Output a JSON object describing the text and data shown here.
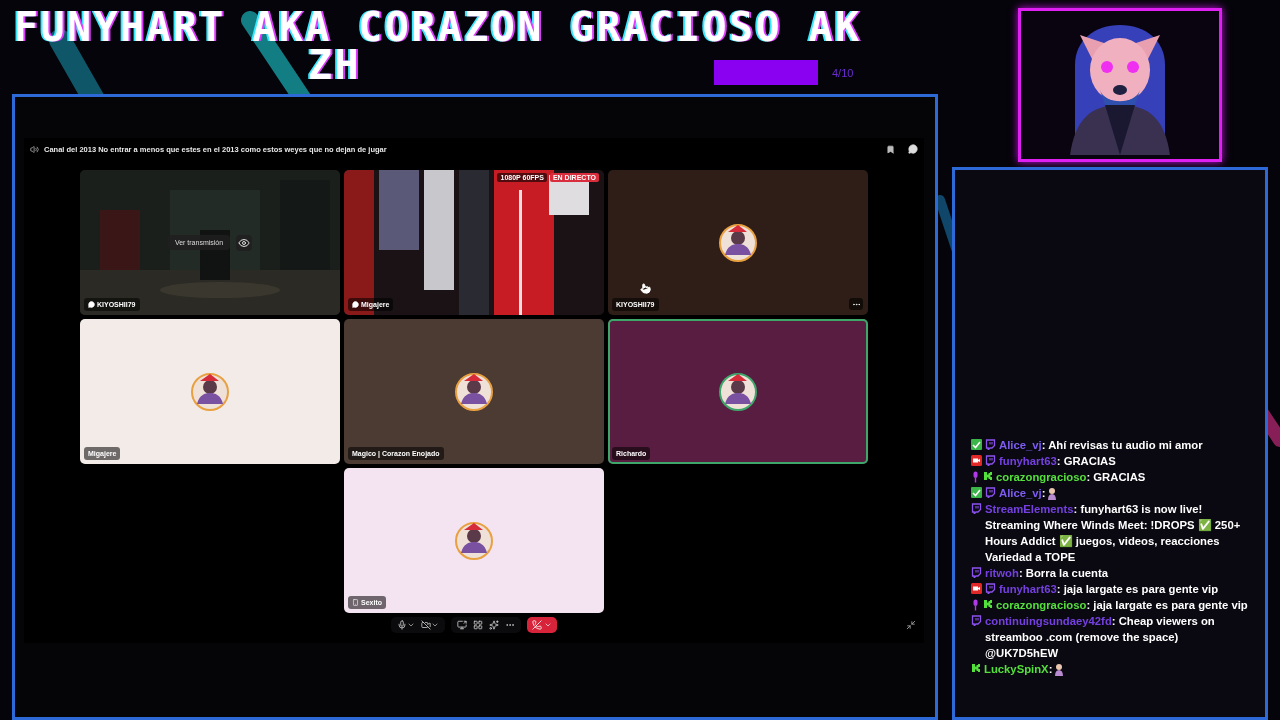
{
  "overlay": {
    "title_lines": [
      "FUNYHART AKA CORAZON GRACIOSO AK",
      "ZH"
    ],
    "goal": {
      "count": "4/10"
    }
  },
  "call": {
    "channel": "Canal del 2013 No entrar a menos que estes en el 2013 como estos weyes que no dejan de jugar",
    "tiles": [
      {
        "kind": "stream",
        "name": "KIYOSHII79",
        "tag_icon": {
          "kind": "chat"
        },
        "button": "Ver transmisión",
        "speaking": false
      },
      {
        "kind": "video",
        "name": "Migajere",
        "tag_icon": {
          "kind": "chat"
        },
        "quality": "1080P 60FPS",
        "live": "EN DIRECTO",
        "speaking": false
      },
      {
        "kind": "avatar",
        "name": "KIYOSHII79",
        "color": "#2e1e17",
        "menu": true,
        "speaking": false
      },
      {
        "kind": "avatar",
        "name": "Migajere",
        "color": "#f3ebe8",
        "speaking": false
      },
      {
        "kind": "avatar",
        "name": "Magico | Corazon Enojado",
        "color": "#4b3b33",
        "speaking": false
      },
      {
        "kind": "avatar",
        "name": "Richardo",
        "color": "#5a1d42",
        "speaking": true
      },
      {
        "kind": "avatar",
        "name": "Sexito",
        "tag_icon": {
          "kind": "phone"
        },
        "color": "#f4e3f0",
        "speaking": false
      }
    ]
  },
  "chat": {
    "messages": [
      {
        "badges": [
          {
            "kind": "check"
          },
          {
            "kind": "twitch"
          }
        ],
        "user": "Alice_vj",
        "color": "#7d5cf2",
        "text": ": Ahí revisas tu audio mi amor"
      },
      {
        "badges": [
          {
            "kind": "broadcaster"
          },
          {
            "kind": "twitch"
          }
        ],
        "user": "funyhart63",
        "color": "#7440e0",
        "text": ": GRACIAS"
      },
      {
        "badges": [
          {
            "kind": "mic"
          },
          {
            "kind": "kick"
          }
        ],
        "user": "corazongracioso",
        "color": "#53e03c",
        "text": ": GRACIAS"
      },
      {
        "badges": [
          {
            "kind": "check"
          },
          {
            "kind": "twitch"
          }
        ],
        "user": "Alice_vj",
        "color": "#7d5cf2",
        "text": ":",
        "emote": true
      },
      {
        "badges": [
          {
            "kind": "twitch"
          }
        ],
        "user": "StreamElements",
        "color": "#7440e0",
        "text": ": funyhart63 is now live! Streaming Where Winds Meet: !DROPS ✅ 250+ Hours Addict ✅ juegos, videos, reacciones Variedad a TOPE"
      },
      {
        "badges": [
          {
            "kind": "twitch"
          }
        ],
        "user": "ritwoh",
        "color": "#7440e0",
        "text": ": Borra la cuenta"
      },
      {
        "badges": [
          {
            "kind": "broadcaster"
          },
          {
            "kind": "twitch"
          }
        ],
        "user": "funyhart63",
        "color": "#7440e0",
        "text": ": jaja largate es para gente vip"
      },
      {
        "badges": [
          {
            "kind": "mic"
          },
          {
            "kind": "kick"
          }
        ],
        "user": "corazongracioso",
        "color": "#53e03c",
        "text": ": jaja largate es para gente vip"
      },
      {
        "badges": [
          {
            "kind": "twitch"
          }
        ],
        "user": "continuingsundaey42fd",
        "color": "#7440e0",
        "text": ": Cheap viewers on streamboo .com (remove the space) @UK7D5hEW"
      },
      {
        "badges": [
          {
            "kind": "kick"
          }
        ],
        "user": "LuckySpinX",
        "color": "#53e03c",
        "text": ":",
        "emote": true
      }
    ]
  }
}
